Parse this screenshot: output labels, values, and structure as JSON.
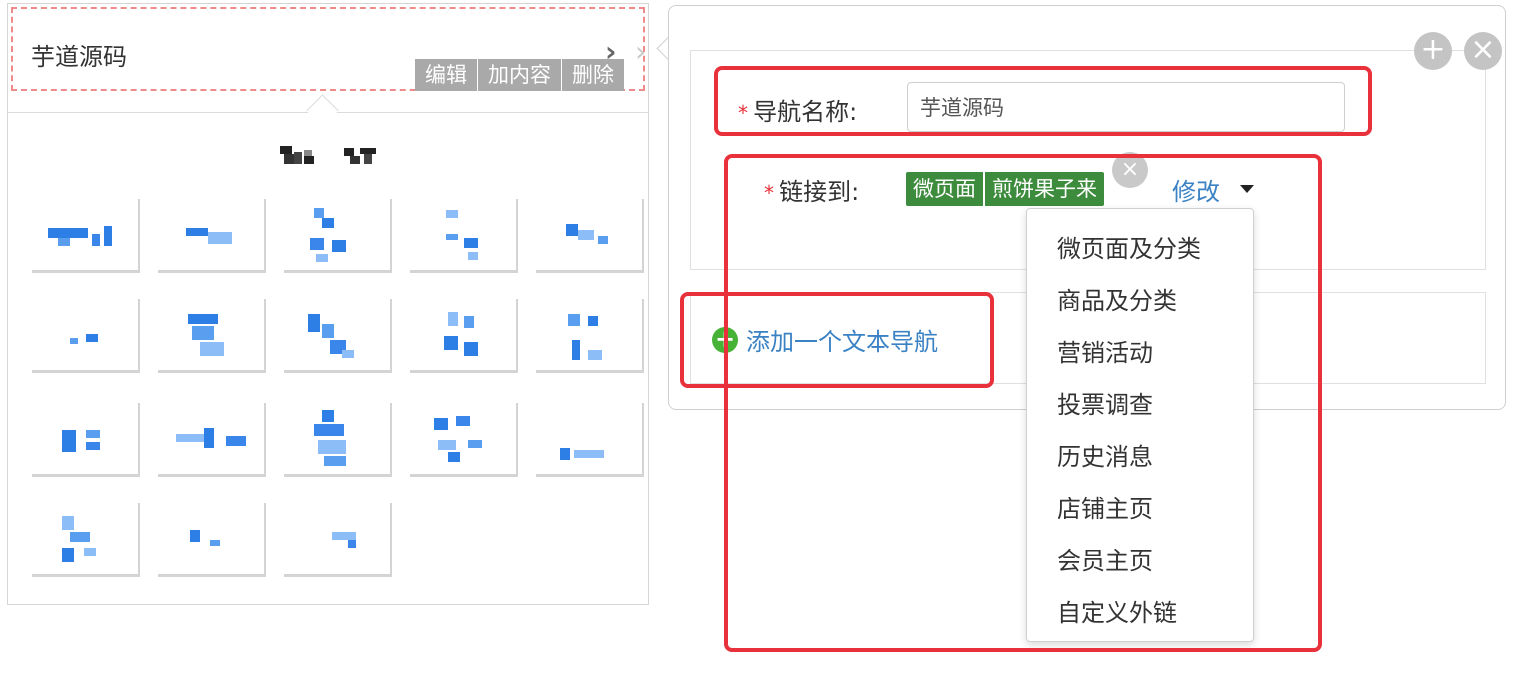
{
  "preview": {
    "title": "芋道源码",
    "actions": [
      "编辑",
      "加内容",
      "删除"
    ]
  },
  "editor": {
    "name_label": "导航名称:",
    "name_value": "芋道源码",
    "link_label": "链接到:",
    "link_badge": [
      "微页面",
      "煎饼果子来"
    ],
    "modify_label": "修改",
    "add_nav_label": "添加一个文本导航"
  },
  "dropdown": {
    "options": [
      "微页面及分类",
      "商品及分类",
      "营销活动",
      "投票调查",
      "历史消息",
      "店铺主页",
      "会员主页",
      "自定义外链"
    ]
  },
  "icons": {
    "add": "plus-circle-icon",
    "close": "close-circle-icon",
    "nav_arrow": "chevron-right-icon",
    "dropdown": "caret-down-icon",
    "add_nav": "plus-circle-icon"
  },
  "colors": {
    "accent_link": "#3a82c4",
    "badge_green": "#3d8b3d",
    "highlight_red": "#e8313a",
    "add_green": "#46b336"
  }
}
